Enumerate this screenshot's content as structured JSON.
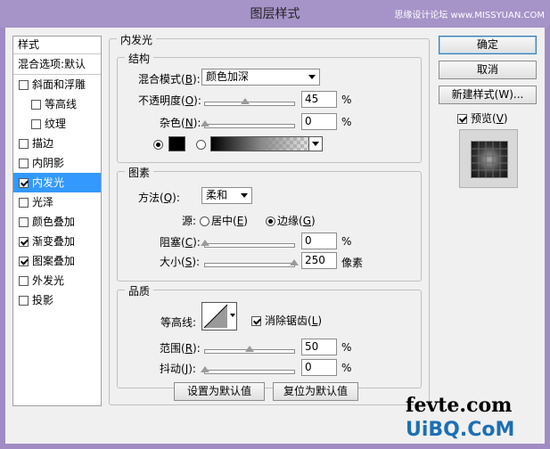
{
  "window": {
    "title": "图层样式",
    "watermark": "思缘设计论坛 www.MISSYUAN.COM"
  },
  "style_list": {
    "header": "样式",
    "blend_options": "混合选项:默认",
    "items": [
      {
        "label": "斜面和浮雕",
        "checked": false
      },
      {
        "label": "等高线",
        "checked": false
      },
      {
        "label": "纹理",
        "checked": false
      },
      {
        "label": "描边",
        "checked": false
      },
      {
        "label": "内阴影",
        "checked": false
      },
      {
        "label": "内发光",
        "checked": true
      },
      {
        "label": "光泽",
        "checked": false
      },
      {
        "label": "颜色叠加",
        "checked": false
      },
      {
        "label": "渐变叠加",
        "checked": true
      },
      {
        "label": "图案叠加",
        "checked": true
      },
      {
        "label": "外发光",
        "checked": false
      },
      {
        "label": "投影",
        "checked": false
      }
    ]
  },
  "panel": {
    "title": "内发光",
    "structure": {
      "title": "结构",
      "blend_mode_label": "混合模式",
      "blend_mode_key": "B",
      "blend_mode_value": "颜色加深",
      "opacity_label": "不透明度",
      "opacity_key": "O",
      "opacity_value": "45",
      "opacity_percent": 45,
      "noise_label": "杂色",
      "noise_key": "N",
      "noise_value": "0",
      "noise_percent": 0,
      "unit": "%",
      "glow_color": "#000000"
    },
    "elements": {
      "title": "图素",
      "method_label": "方法",
      "method_key": "Q",
      "method_value": "柔和",
      "source_label": "源:",
      "source_center": "居中",
      "source_center_key": "E",
      "source_edge": "边缘",
      "source_edge_key": "G",
      "choke_label": "阻塞",
      "choke_key": "C",
      "choke_value": "0",
      "choke_percent": 0,
      "size_label": "大小",
      "size_key": "S",
      "size_value": "250",
      "size_fraction": 1.0,
      "size_unit": "像素",
      "unit": "%"
    },
    "quality": {
      "title": "品质",
      "contour_label": "等高线:",
      "antialias_label": "消除锯齿",
      "antialias_key": "L",
      "range_label": "范围",
      "range_key": "R",
      "range_value": "50",
      "range_percent": 50,
      "jitter_label": "抖动",
      "jitter_key": "J",
      "jitter_value": "0",
      "jitter_percent": 0,
      "unit": "%"
    },
    "make_default": "设置为默认值",
    "reset_default": "复位为默认值"
  },
  "buttons": {
    "ok": "确定",
    "cancel": "取消",
    "new_style": "新建样式(W)...",
    "preview_label": "预览",
    "preview_key": "V"
  },
  "site_watermark": {
    "line1": "fevte.com",
    "line2": "UiBQ.CoM"
  }
}
